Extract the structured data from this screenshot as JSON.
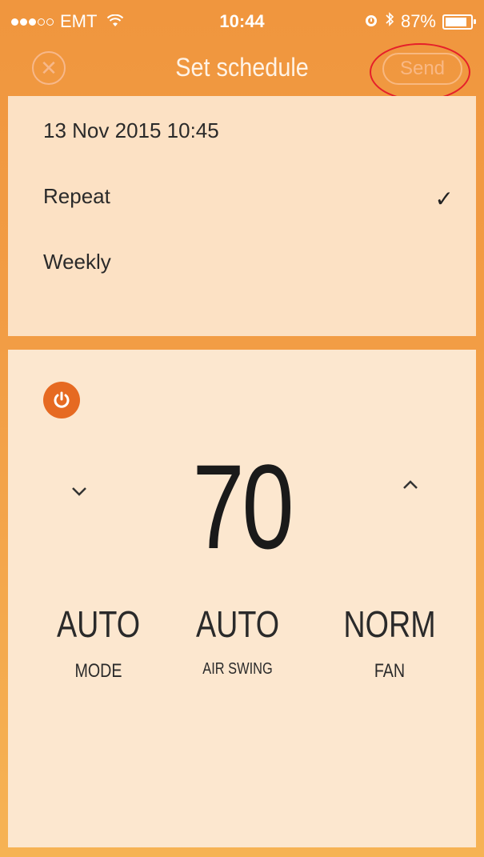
{
  "status_bar": {
    "carrier": "EMT",
    "time": "10:44",
    "battery": "87%",
    "battery_level": 0.87
  },
  "nav": {
    "title": "Set schedule",
    "send_label": "Send"
  },
  "schedule": {
    "datetime": "13 Nov 2015 10:45",
    "repeat_label": "Repeat",
    "repeat_checked": true,
    "frequency": "Weekly"
  },
  "controls": {
    "temperature": "70",
    "mode_value": "AUTO",
    "mode_label": "MODE",
    "air_swing_value": "AUTO",
    "air_swing_label": "AIR SWING",
    "fan_value": "NORM",
    "fan_label": "FAN"
  },
  "colors": {
    "accent": "#f0963e",
    "power_button": "#e66a22",
    "highlight": "#e5202a"
  },
  "icons": {
    "close": "close-icon",
    "check": "checkmark-icon",
    "power": "power-icon",
    "down": "chevron-down-icon",
    "up": "chevron-up-icon"
  }
}
